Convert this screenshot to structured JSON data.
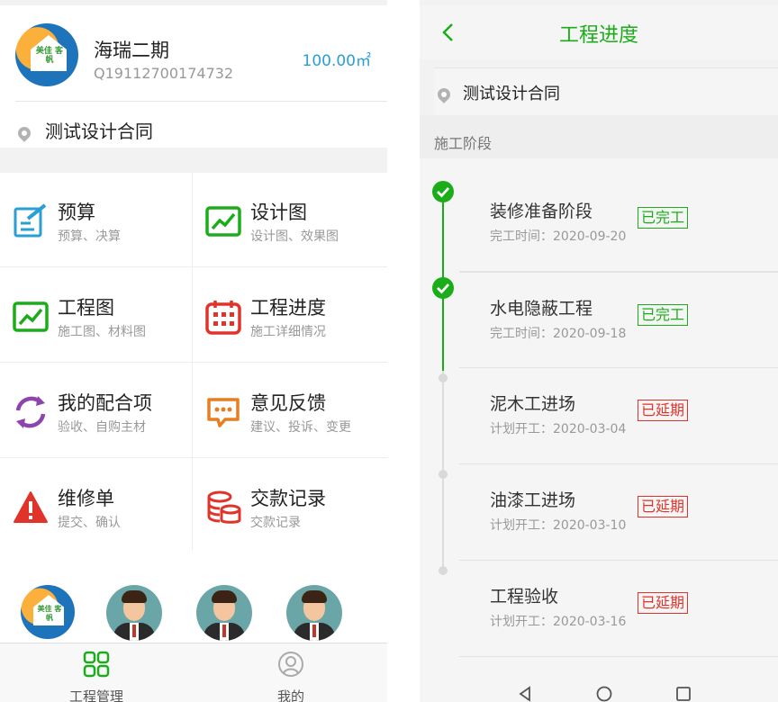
{
  "left": {
    "project": {
      "name": "海瑞二期",
      "code": "Q19112700174732",
      "area": "100.00㎡",
      "address": "测试设计合同",
      "logo_text": "美佳 客帆"
    },
    "menu": [
      {
        "title": "预算",
        "subtitle": "预算、决算",
        "icon": "edit-document-icon",
        "color": "#2a9fd6"
      },
      {
        "title": "设计图",
        "subtitle": "设计图、效果图",
        "icon": "image-chart-icon",
        "color": "#1aad19"
      },
      {
        "title": "工程图",
        "subtitle": "施工图、材料图",
        "icon": "image-chart-icon",
        "color": "#1aad19"
      },
      {
        "title": "工程进度",
        "subtitle": "施工详细情况",
        "icon": "calendar-icon",
        "color": "#e0342b"
      },
      {
        "title": "我的配合项",
        "subtitle": "验收、自购主材",
        "icon": "refresh-cycle-icon",
        "color": "#8e44ad"
      },
      {
        "title": "意见反馈",
        "subtitle": "建议、投诉、变更",
        "icon": "chat-bubble-icon",
        "color": "#e67e22"
      },
      {
        "title": "维修单",
        "subtitle": "提交、确认",
        "icon": "warning-icon",
        "color": "#e0342b"
      },
      {
        "title": "交款记录",
        "subtitle": "交款记录",
        "icon": "coins-database-icon",
        "color": "#e0342b"
      }
    ],
    "nav": [
      {
        "label": "工程管理",
        "icon": "grid-apps-icon",
        "active": true
      },
      {
        "label": "我的",
        "icon": "user-profile-icon",
        "active": false
      }
    ],
    "colors": {
      "active": "#1aad19",
      "inactive": "#555555"
    }
  },
  "right": {
    "title": "工程进度",
    "address": "测试设计合同",
    "section": "施工阶段",
    "stages": [
      {
        "name": "装修准备阶段",
        "date": "完工时间：2020-09-20",
        "status": "已完工",
        "state": "done"
      },
      {
        "name": "水电隐蔽工程",
        "date": "完工时间：2020-09-18",
        "status": "已完工",
        "state": "done"
      },
      {
        "name": "泥木工进场",
        "date": "计划开工：2020-03-04",
        "status": "已延期",
        "state": "late"
      },
      {
        "name": "油漆工进场",
        "date": "计划开工：2020-03-10",
        "status": "已延期",
        "state": "late"
      },
      {
        "name": "工程验收",
        "date": "计划开工：2020-03-16",
        "status": "已延期",
        "state": "late"
      }
    ]
  }
}
